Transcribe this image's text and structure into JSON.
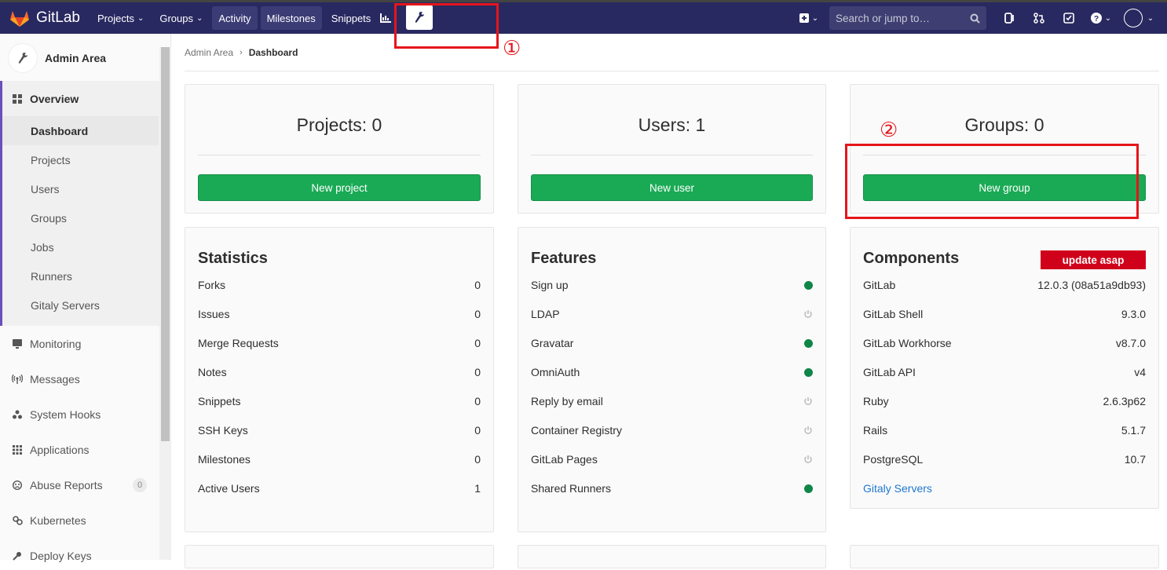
{
  "nav": {
    "brand": "GitLab",
    "items": [
      {
        "label": "Projects",
        "has_caret": true
      },
      {
        "label": "Groups",
        "has_caret": true
      },
      {
        "label": "Activity",
        "has_caret": false
      },
      {
        "label": "Milestones",
        "has_caret": false
      },
      {
        "label": "Snippets",
        "has_caret": false
      }
    ],
    "search_placeholder": "Search or jump to…"
  },
  "sidebar": {
    "title": "Admin Area",
    "overview": "Overview",
    "sub_items": [
      "Dashboard",
      "Projects",
      "Users",
      "Groups",
      "Jobs",
      "Runners",
      "Gitaly Servers"
    ],
    "items": [
      {
        "label": "Monitoring",
        "icon": "monitor-icon"
      },
      {
        "label": "Messages",
        "icon": "broadcast-icon"
      },
      {
        "label": "System Hooks",
        "icon": "hook-icon"
      },
      {
        "label": "Applications",
        "icon": "apps-grid-icon"
      },
      {
        "label": "Abuse Reports",
        "icon": "abuse-icon",
        "count": "0"
      },
      {
        "label": "Kubernetes",
        "icon": "kubernetes-icon"
      },
      {
        "label": "Deploy Keys",
        "icon": "key-icon"
      }
    ]
  },
  "breadcrumb": {
    "parent": "Admin Area",
    "current": "Dashboard"
  },
  "counts": [
    {
      "title": "Projects: 0",
      "button": "New project"
    },
    {
      "title": "Users: 1",
      "button": "New user"
    },
    {
      "title": "Groups: 0",
      "button": "New group"
    }
  ],
  "statistics": {
    "title": "Statistics",
    "rows": [
      {
        "label": "Forks",
        "value": "0"
      },
      {
        "label": "Issues",
        "value": "0"
      },
      {
        "label": "Merge Requests",
        "value": "0"
      },
      {
        "label": "Notes",
        "value": "0"
      },
      {
        "label": "Snippets",
        "value": "0"
      },
      {
        "label": "SSH Keys",
        "value": "0"
      },
      {
        "label": "Milestones",
        "value": "0"
      },
      {
        "label": "Active Users",
        "value": "1"
      }
    ]
  },
  "features": {
    "title": "Features",
    "rows": [
      {
        "label": "Sign up",
        "enabled": true
      },
      {
        "label": "LDAP",
        "enabled": false
      },
      {
        "label": "Gravatar",
        "enabled": true
      },
      {
        "label": "OmniAuth",
        "enabled": true
      },
      {
        "label": "Reply by email",
        "enabled": false
      },
      {
        "label": "Container Registry",
        "enabled": false
      },
      {
        "label": "GitLab Pages",
        "enabled": false
      },
      {
        "label": "Shared Runners",
        "enabled": true
      }
    ]
  },
  "components": {
    "title": "Components",
    "badge": "update asap",
    "rows": [
      {
        "label": "GitLab",
        "value": "12.0.3 (08a51a9db93)"
      },
      {
        "label": "GitLab Shell",
        "value": "9.3.0"
      },
      {
        "label": "GitLab Workhorse",
        "value": "v8.7.0"
      },
      {
        "label": "GitLab API",
        "value": "v4"
      },
      {
        "label": "Ruby",
        "value": "2.6.3p62"
      },
      {
        "label": "Rails",
        "value": "5.1.7"
      },
      {
        "label": "PostgreSQL",
        "value": "10.7"
      }
    ],
    "link": "Gitaly Servers"
  },
  "annotations": {
    "marker1": "①",
    "marker2": "②"
  },
  "colors": {
    "navbar": "#292961",
    "button": "#1aaa55",
    "enabled": "#108548",
    "danger": "#d0021b",
    "annotation": "#e5151b"
  }
}
